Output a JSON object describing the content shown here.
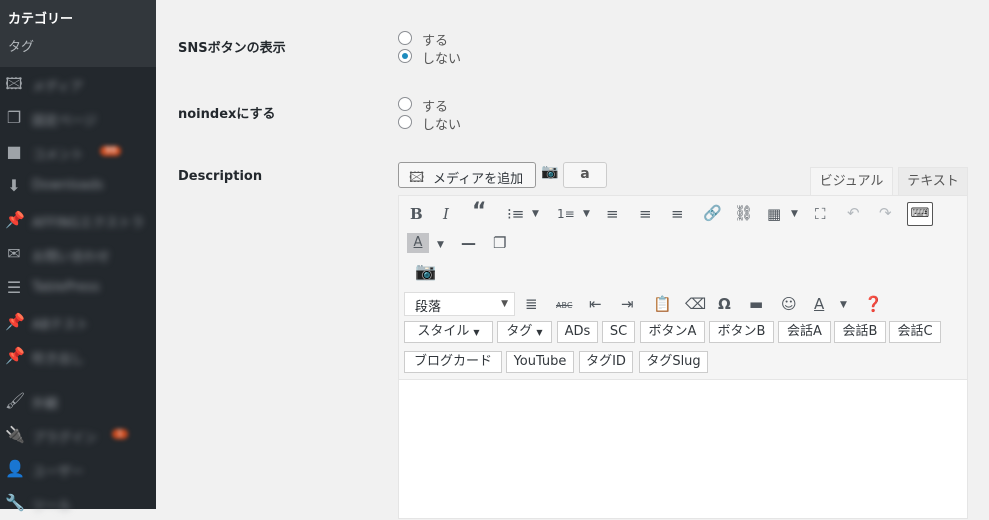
{
  "sidebar": {
    "submenu": [
      "カテゴリー",
      "タグ"
    ],
    "items": [
      {
        "icon": "media-icon",
        "glyph": "🖾",
        "label": "メディア",
        "badge": ""
      },
      {
        "icon": "pages-icon",
        "glyph": "❐",
        "label": "固定ページ",
        "badge": ""
      },
      {
        "icon": "comments-icon",
        "glyph": "■",
        "label": "コメント",
        "badge": "99"
      },
      {
        "icon": "download-icon",
        "glyph": "⬇",
        "label": "Downloads",
        "badge": ""
      },
      {
        "icon": "pin-icon",
        "glyph": "📌",
        "label": "AFFINGエクストラ",
        "badge": ""
      },
      {
        "icon": "mail-icon",
        "glyph": "✉",
        "label": "お問い合わせ",
        "badge": ""
      },
      {
        "icon": "table-icon",
        "glyph": "☰",
        "label": "TablePress",
        "badge": ""
      },
      {
        "icon": "pin-icon",
        "glyph": "📌",
        "label": "ABテスト",
        "badge": ""
      },
      {
        "icon": "pin-icon",
        "glyph": "📌",
        "label": "吹き出し",
        "badge": ""
      },
      {
        "icon": "appearance-icon",
        "glyph": "🖌",
        "label": "外観",
        "badge": ""
      },
      {
        "icon": "plugins-icon",
        "glyph": "🔌",
        "label": "プラグイン",
        "badge": "1"
      },
      {
        "icon": "users-icon",
        "glyph": "👤",
        "label": "ユーザー",
        "badge": ""
      },
      {
        "icon": "tools-icon",
        "glyph": "🔧",
        "label": "ツール",
        "badge": ""
      }
    ]
  },
  "form": {
    "sns": {
      "label": "SNSボタンの表示",
      "options": [
        "する",
        "しない"
      ],
      "selected": 1
    },
    "noindex": {
      "label": "noindexにする",
      "options": [
        "する",
        "しない"
      ],
      "selected": -1
    },
    "description": {
      "label": "Description"
    }
  },
  "editor": {
    "add_media": "メディアを追加",
    "amazon": "a",
    "tab_visual": "ビジュアル",
    "tab_text": "テキスト",
    "format_value": "段落",
    "row5": [
      {
        "label": "スタイル",
        "dropdown": true
      },
      {
        "label": "タグ",
        "dropdown": true
      },
      {
        "label": "ADs",
        "dropdown": false
      },
      {
        "label": "SC",
        "dropdown": false
      },
      {
        "label": "ボタンA",
        "dropdown": false
      },
      {
        "label": "ボタンB",
        "dropdown": false
      },
      {
        "label": "会話A",
        "dropdown": false
      },
      {
        "label": "会話B",
        "dropdown": false
      },
      {
        "label": "会話C",
        "dropdown": false
      }
    ],
    "row6": [
      "ブログカード",
      "YouTube",
      "タグID",
      "タグSlug"
    ],
    "accent": "#1e8cbe"
  }
}
